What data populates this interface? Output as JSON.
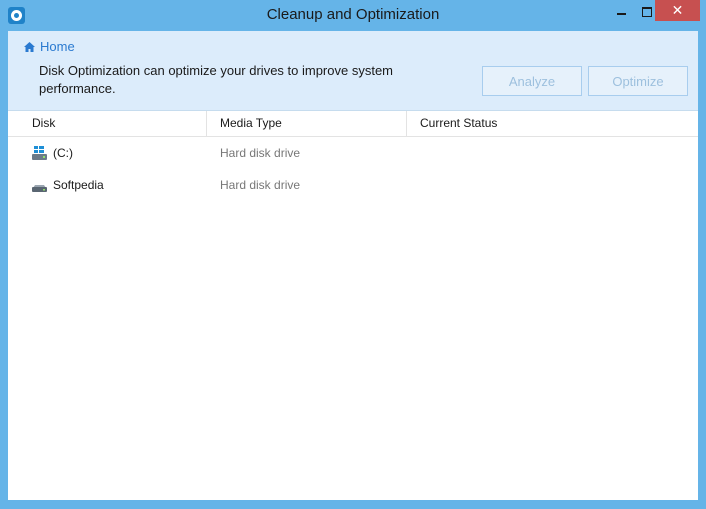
{
  "window": {
    "title": "Cleanup and Optimization",
    "close_glyph": "✕"
  },
  "header": {
    "breadcrumb": "Home",
    "description": "Disk Optimization can optimize your drives to improve system performance.",
    "analyze_label": "Analyze",
    "optimize_label": "Optimize"
  },
  "table": {
    "columns": [
      "Disk",
      "Media Type",
      "Current Status"
    ],
    "rows": [
      {
        "disk": "(C:)",
        "icon": "windows-drive-icon",
        "media_type": "Hard disk drive",
        "status": ""
      },
      {
        "disk": "Softpedia",
        "icon": "hard-drive-icon",
        "media_type": "Hard disk drive",
        "status": ""
      }
    ]
  },
  "colors": {
    "frame": "#65b4e8",
    "header_bg": "#dcecfb",
    "link": "#2a7ad0",
    "disabled_button_text": "#9dc0de",
    "close_button": "#c75050"
  }
}
